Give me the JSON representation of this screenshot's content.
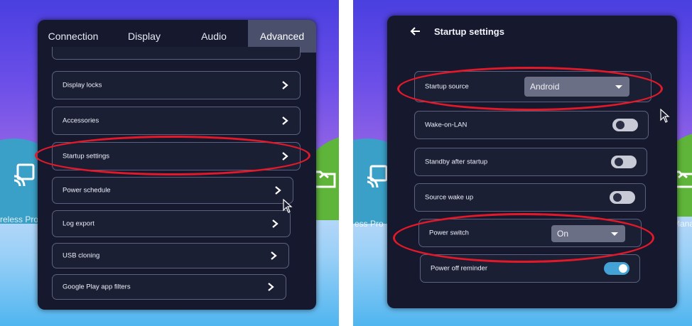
{
  "left_screen": {
    "tabs": [
      {
        "label": "Connection"
      },
      {
        "label": "Display"
      },
      {
        "label": "Audio"
      },
      {
        "label": "Advanced",
        "active": true
      }
    ],
    "menu_items": [
      {
        "label": "Display locks"
      },
      {
        "label": "Accessories"
      },
      {
        "label": "Startup settings",
        "highlighted": true
      },
      {
        "label": "Power schedule"
      },
      {
        "label": "Log export"
      },
      {
        "label": "USB cloning"
      },
      {
        "label": "Google Play app filters"
      }
    ],
    "background_caption": "reless Proj"
  },
  "right_screen": {
    "title": "Startup settings",
    "settings": [
      {
        "label": "Startup source",
        "control": "dropdown",
        "value": "Android",
        "highlighted": true
      },
      {
        "label": "Wake-on-LAN",
        "control": "toggle",
        "state": "off"
      },
      {
        "label": "Standby after startup",
        "control": "toggle",
        "state": "off"
      },
      {
        "label": "Source wake up",
        "control": "toggle",
        "state": "off"
      },
      {
        "label": "Power switch",
        "control": "dropdown",
        "value": "On",
        "highlighted": true
      },
      {
        "label": "Power off reminder",
        "control": "toggle",
        "state": "on"
      }
    ],
    "background_caption_left": "ess Pro",
    "background_caption_right": "e Mana"
  },
  "colors": {
    "panel": "#16192d",
    "active_tab": "#4a4f6c",
    "highlight_ellipse": "#e3192a",
    "toggle_on": "#43a2d6"
  }
}
